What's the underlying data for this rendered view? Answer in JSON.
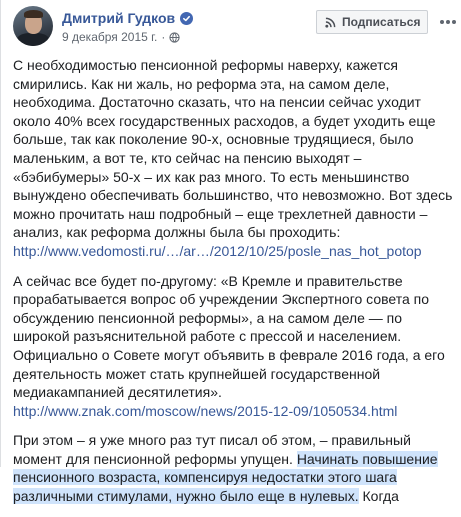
{
  "post": {
    "author": "Дмитрий Гудков",
    "date": "9 декабря 2015 г.",
    "subscribe_label": "Подписаться",
    "paragraphs": [
      {
        "text": "С необходимостью пенсионной реформы наверху, кажется смирились. Как ни жаль, но реформа эта, на самом деле, необходима. Достаточно сказать, что на пенсии сейчас уходит около 40% всех государственных расходов, а будет уходить еще больше, так как поколение 90-х, основные трудящиеся, было маленьким, а вот те, кто сейчас на пенсию выходят – «бэбибумеры» 50-х – их как раз много. То есть меньшинство вынуждено обеспечивать большинство, что невозможно. Вот здесь можно прочитать наш подробный – еще трехлетней давности – анализ, как реформа должны была бы проходить: ",
        "link": "http://www.vedomosti.ru/…/ar…/2012/10/25/posle_nas_hot_potop"
      },
      {
        "text": "А сейчас все будет по-другому: «В Кремле и правительстве прорабатывается вопрос об учреждении Экспертного совета по обсуждению пенсионной реформы», а на самом деле — по широкой разъяснительной работе с прессой и населением. Официально о Совете могут объявить в феврале 2016 года, а его деятельность может стать крупнейшей государственной медиакампанией десятилетия». ",
        "link": "http://www.znak.com/moscow/news/2015-12-09/1050534.html"
      },
      {
        "text": "При этом – я уже много раз тут писал об этом, – правильный момент для пенсионной реформы упущен. ",
        "highlight": "Начинать повышение пенсионного возраста, компенсируя недостатки этого шага различными стимулами, нужно было еще в нулевых.",
        "tail": " Когда"
      }
    ]
  },
  "colors": {
    "link": "#385898",
    "highlight": "#cfe3fb",
    "verified": "#4267b2"
  },
  "icons": [
    "verified-badge-icon",
    "globe-icon",
    "rss-icon",
    "more-options-icon"
  ]
}
